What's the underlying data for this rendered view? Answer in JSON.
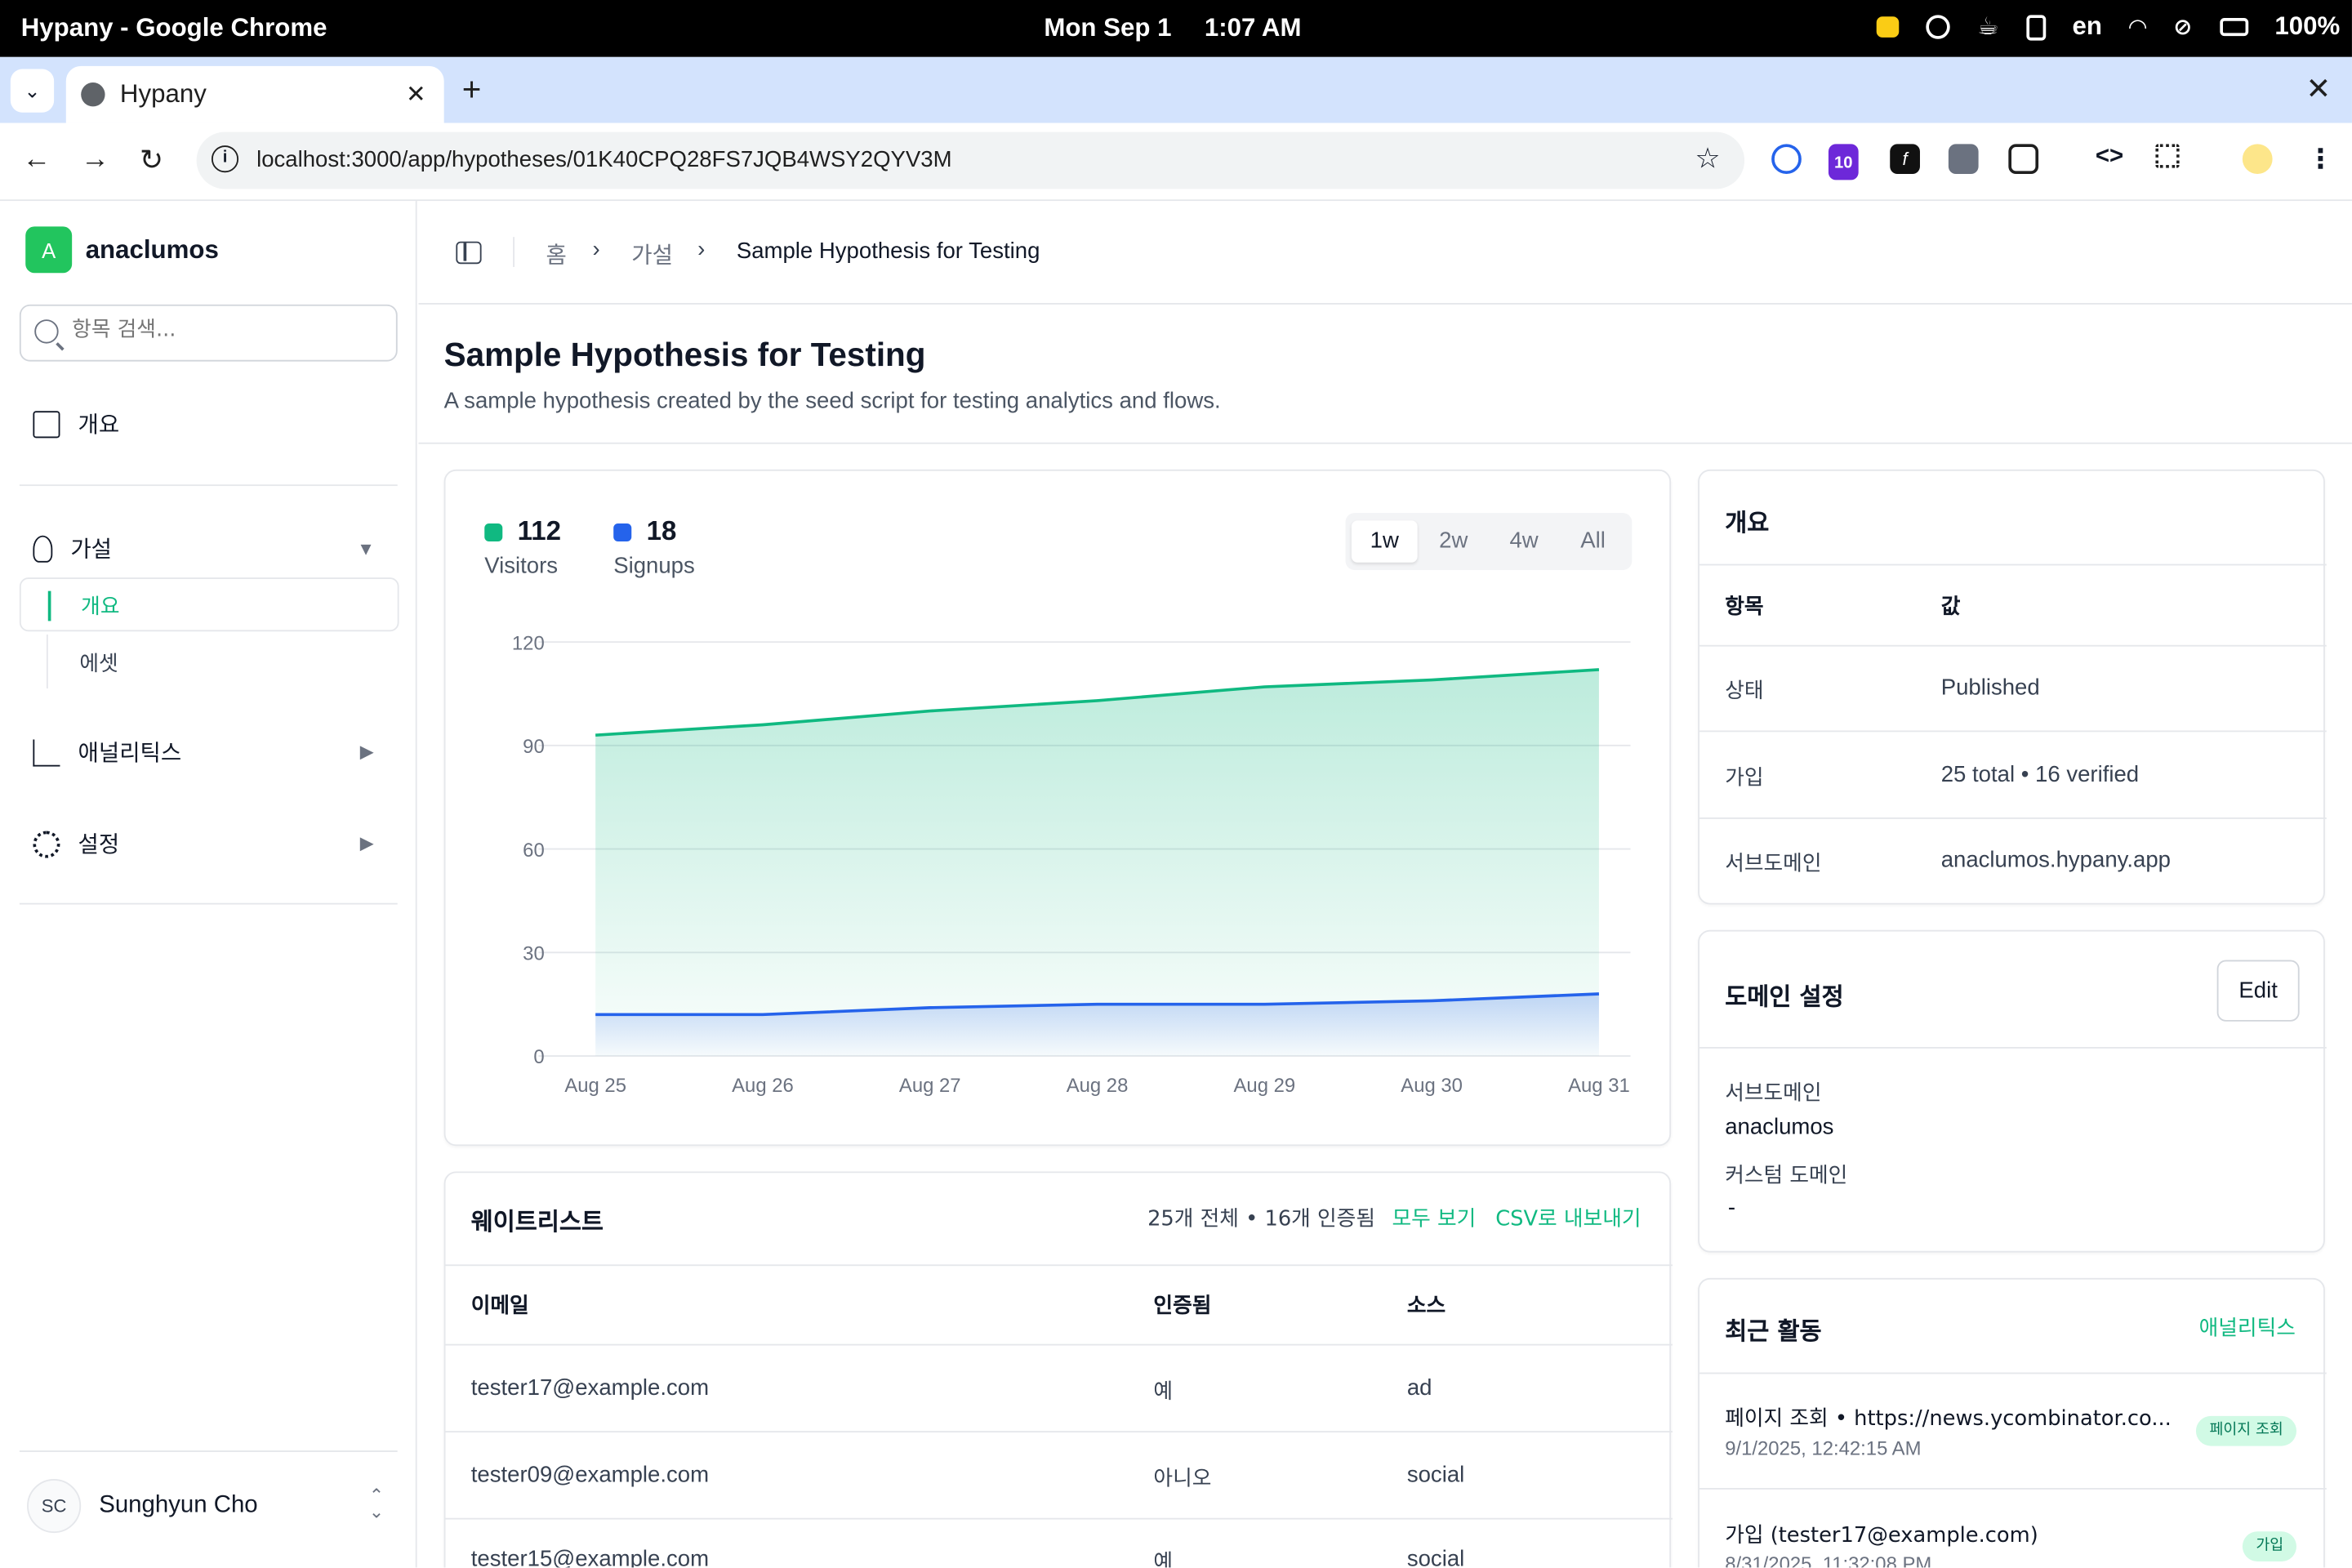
{
  "os": {
    "app_title": "Hypany - Google Chrome",
    "date": "Mon Sep 1",
    "time": "1:07 AM",
    "lang": "en",
    "battery": "100%"
  },
  "browser": {
    "tab_title": "Hypany",
    "url": "localhost:3000/app/hypotheses/01K40CPQ28FS7JQB4WSY2QYV3M",
    "ext_badge": "10"
  },
  "sidebar": {
    "brand_initial": "A",
    "brand": "anaclumos",
    "search_placeholder": "항목 검색...",
    "overview": "개요",
    "hypotheses": "가설",
    "sub_overview": "개요",
    "sub_assets": "에셋",
    "analytics": "애널리틱스",
    "settings": "설정",
    "user_initials": "SC",
    "user_name": "Sunghyun Cho"
  },
  "breadcrumb": {
    "home": "홈",
    "hypotheses": "가설",
    "current": "Sample Hypothesis for Testing"
  },
  "page": {
    "title": "Sample Hypothesis for Testing",
    "description": "A sample hypothesis created by the seed script for testing analytics and flows."
  },
  "stats": {
    "visitors_value": "112",
    "visitors_label": "Visitors",
    "signups_value": "18",
    "signups_label": "Signups"
  },
  "range": {
    "options": [
      "1w",
      "2w",
      "4w",
      "All"
    ],
    "selected": "1w"
  },
  "chart_data": {
    "type": "area",
    "categories": [
      "Aug 25",
      "Aug 26",
      "Aug 27",
      "Aug 28",
      "Aug 29",
      "Aug 30",
      "Aug 31"
    ],
    "series": [
      {
        "name": "Visitors",
        "color": "#10b981",
        "values": [
          93,
          96,
          100,
          103,
          107,
          109,
          112
        ]
      },
      {
        "name": "Signups",
        "color": "#2563eb",
        "values": [
          12,
          12,
          14,
          15,
          15,
          16,
          18
        ]
      }
    ],
    "ylim": [
      0,
      120
    ],
    "yticks": [
      0,
      30,
      60,
      90,
      120
    ],
    "grid": true
  },
  "waitlist": {
    "title": "웨이트리스트",
    "summary": "25개 전체 • 16개 인증됨",
    "view_all": "모두 보기",
    "export_csv": "CSV로 내보내기",
    "headers": [
      "이메일",
      "인증됨",
      "소스"
    ],
    "rows": [
      [
        "tester17@example.com",
        "예",
        "ad"
      ],
      [
        "tester09@example.com",
        "아니오",
        "social"
      ],
      [
        "tester15@example.com",
        "예",
        "social"
      ]
    ]
  },
  "overview_card": {
    "title": "개요",
    "headers": [
      "항목",
      "값"
    ],
    "rows": [
      [
        "상태",
        "Published"
      ],
      [
        "가입",
        "25 total • 16 verified"
      ],
      [
        "서브도메인",
        "anaclumos.hypany.app"
      ]
    ]
  },
  "domain_card": {
    "title": "도메인 설정",
    "edit": "Edit",
    "subdomain_label": "서브도메인",
    "subdomain_value": "anaclumos",
    "custom_label": "커스텀 도메인",
    "custom_value": "-"
  },
  "activity_card": {
    "title": "최근 활동",
    "link": "애널리틱스",
    "items": [
      {
        "text": "페이지 조회 • https://news.ycombinator.co...",
        "time": "9/1/2025, 12:42:15 AM",
        "badge": "페이지 조회"
      },
      {
        "text": "가입 (tester17@example.com)",
        "time": "8/31/2025, 11:32:08 PM",
        "badge": "가입"
      }
    ]
  },
  "colors": {
    "accent": "#10b981",
    "signups": "#2563eb",
    "logo": "#22c55e"
  }
}
